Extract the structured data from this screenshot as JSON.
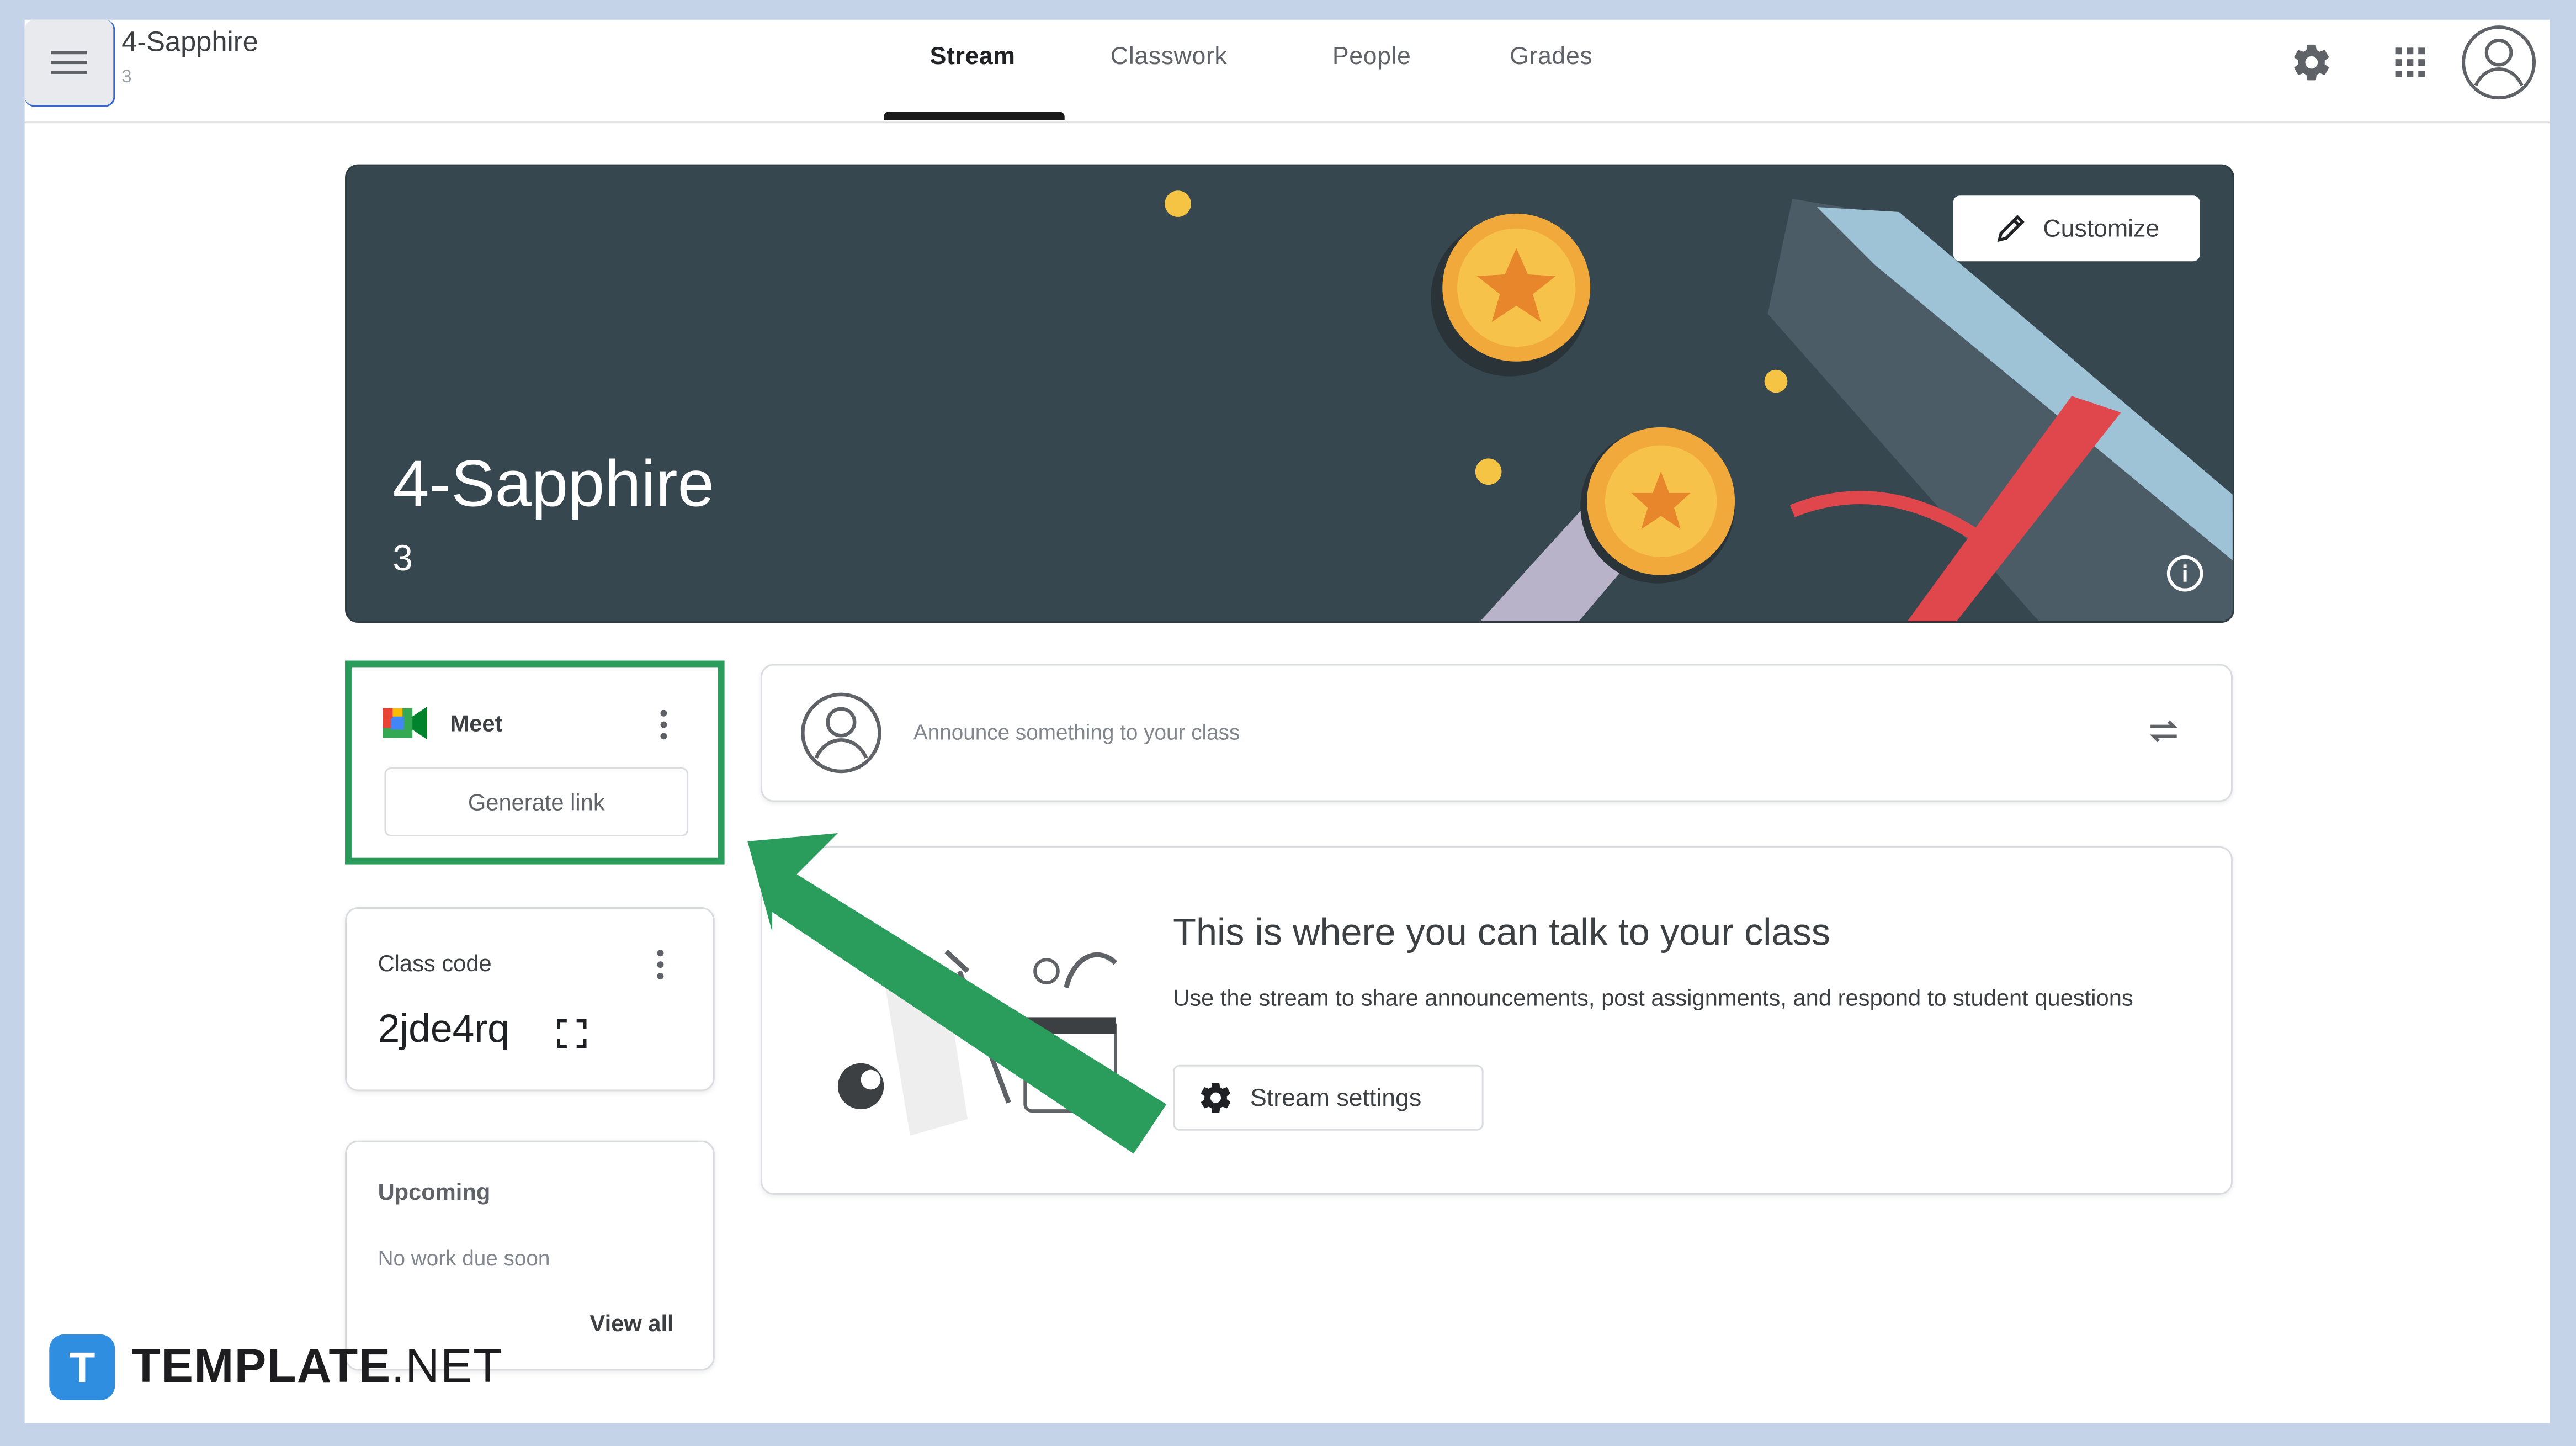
{
  "header": {
    "menu_icon": "hamburger-menu-icon",
    "class_name": "4-Sapphire",
    "class_section": "3",
    "tabs": [
      {
        "label": "Stream",
        "active": true
      },
      {
        "label": "Classwork",
        "active": false
      },
      {
        "label": "People",
        "active": false
      },
      {
        "label": "Grades",
        "active": false
      }
    ],
    "icons": [
      "gear-icon",
      "apps-grid-icon",
      "account-avatar-icon"
    ]
  },
  "banner": {
    "title": "4-Sapphire",
    "section": "3",
    "customize_label": "Customize",
    "background_color": "#37474f"
  },
  "meet": {
    "label": "Meet",
    "button_label": "Generate link"
  },
  "class_code": {
    "label": "Class code",
    "value": "2jde4rq"
  },
  "upcoming": {
    "label": "Upcoming",
    "empty_text": "No work due soon",
    "view_all_label": "View all"
  },
  "announce": {
    "placeholder": "Announce something to your class"
  },
  "stream_info": {
    "title": "This is where you can talk to your class",
    "description": "Use the stream to share announcements, post assignments, and respond to student questions",
    "settings_label": "Stream settings"
  },
  "watermark": {
    "brand": "TEMPLATE",
    "suffix": ".NET"
  },
  "colors": {
    "highlight_green": "#2a9d5c",
    "frame_background": "#c5d3e9"
  }
}
